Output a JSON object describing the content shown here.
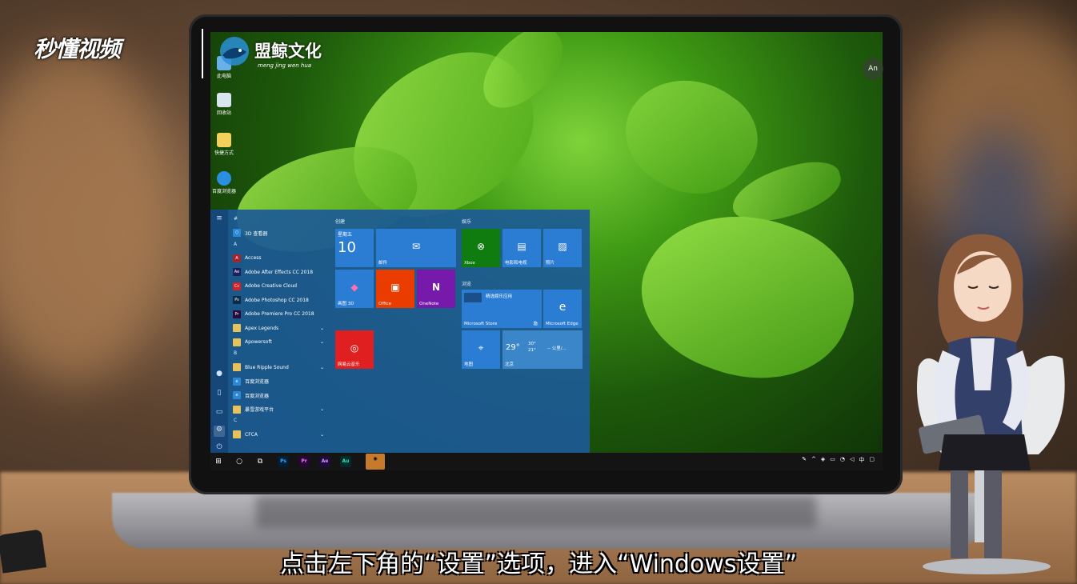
{
  "branding": {
    "channel_logo": "秒懂视频",
    "studio_name": "盟鲸文化",
    "studio_pinyin": "meng jing wen hua"
  },
  "subtitle": "点击左下角的“设置”选项，进入“Windows设置”",
  "screen": {
    "corner_badge": "An",
    "desktop_icons": [
      {
        "label": "此电脑",
        "icon": "computer-icon"
      },
      {
        "label": "回收站",
        "icon": "recycle-bin-icon"
      },
      {
        "label": "快捷方式",
        "icon": "folder-icon"
      },
      {
        "label": "百度浏览器",
        "icon": "browser-icon"
      }
    ],
    "start_menu": {
      "rail": [
        {
          "name": "hamburger",
          "glyph": "≡"
        },
        {
          "name": "user",
          "glyph": "●"
        },
        {
          "name": "documents",
          "glyph": "▯"
        },
        {
          "name": "pictures",
          "glyph": "▭"
        },
        {
          "name": "settings",
          "glyph": "⚙"
        },
        {
          "name": "power",
          "glyph": "⏻"
        }
      ],
      "apps": [
        {
          "type": "letter",
          "text": "#"
        },
        {
          "type": "app",
          "text": "3D 查看器",
          "color": "#2b88d8",
          "glyph": "⬡"
        },
        {
          "type": "letter",
          "text": "A"
        },
        {
          "type": "app",
          "text": "Access",
          "color": "#a4262c",
          "glyph": "A"
        },
        {
          "type": "app",
          "text": "Adobe After Effects CC 2018",
          "color": "#1f1f5c",
          "glyph": "Ae"
        },
        {
          "type": "app",
          "text": "Adobe Creative Cloud",
          "color": "#da1f26",
          "glyph": "Cc"
        },
        {
          "type": "app",
          "text": "Adobe Photoshop CC 2018",
          "color": "#0b2a4a",
          "glyph": "Ps"
        },
        {
          "type": "app",
          "text": "Adobe Premiere Pro CC 2018",
          "color": "#2a0a3a",
          "glyph": "Pr"
        },
        {
          "type": "folder",
          "text": "Apex Legends",
          "color": "#e8c15a",
          "glyph": ""
        },
        {
          "type": "folder",
          "text": "Apowersoft",
          "color": "#e8c15a",
          "glyph": ""
        },
        {
          "type": "letter",
          "text": "B"
        },
        {
          "type": "folder",
          "text": "Blue Ripple Sound",
          "color": "#e8c15a",
          "glyph": ""
        },
        {
          "type": "app",
          "text": "百度浏览器",
          "color": "#2b88d8",
          "glyph": "e"
        },
        {
          "type": "app",
          "text": "百度浏览器",
          "color": "#2b88d8",
          "glyph": "e"
        },
        {
          "type": "folder",
          "text": "暴雪游戏平台",
          "color": "#e8c15a",
          "glyph": ""
        },
        {
          "type": "letter",
          "text": "C"
        },
        {
          "type": "folder",
          "text": "CFCA",
          "color": "#e8c15a",
          "glyph": ""
        }
      ],
      "groups": {
        "create": "创建",
        "play": "娱乐",
        "browse": "浏览"
      },
      "tiles": {
        "calendar_day": "星期五",
        "calendar_date": "10",
        "mail": "邮件",
        "paint3d": "画图 3D",
        "office": "Office",
        "onenote": "OneNote",
        "netease": "网易云音乐",
        "xbox": "Xbox",
        "movies": "电影和电视",
        "photos": "照片",
        "store_featured": "精选娱乐应用",
        "store": "Microsoft Store",
        "edge": "Microsoft Edge",
        "maps": "地图",
        "weather_temp": "29°",
        "weather_high": "30°",
        "weather_low": "21°",
        "weather_wind": "-- 公里/...",
        "weather_city": "北京"
      }
    },
    "taskbar": {
      "apps": [
        "Ps",
        "Pr",
        "Ae",
        "Au"
      ],
      "colors": {
        "Ps": "#31a8ff",
        "Pr": "#e77cff",
        "Ae": "#d291ff",
        "Au": "#2ee5b4"
      }
    }
  },
  "colors": {
    "start_menu_bg": "#1c5a96",
    "tile_blue": "#2b7cd3",
    "xbox_green": "#107c10",
    "office_orange": "#eb3c00",
    "onenote_purple": "#7719aa",
    "netease_red": "#e02020"
  }
}
